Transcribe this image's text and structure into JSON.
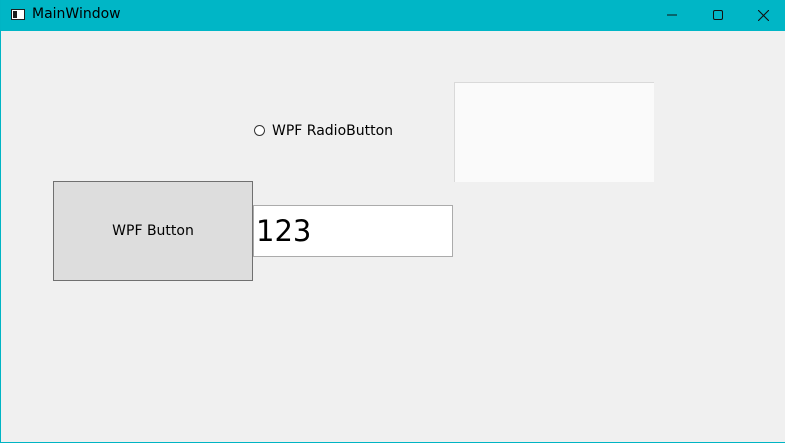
{
  "window": {
    "title": "MainWindow",
    "accent_color": "#00b6c6",
    "icons": {
      "app": "window-app-icon",
      "minimize": "minimize-icon",
      "maximize": "maximize-icon",
      "close": "close-icon"
    }
  },
  "content": {
    "button_label": "WPF Button",
    "radio_label": "WPF RadioButton",
    "radio_checked": false,
    "textbox_value": "123"
  }
}
